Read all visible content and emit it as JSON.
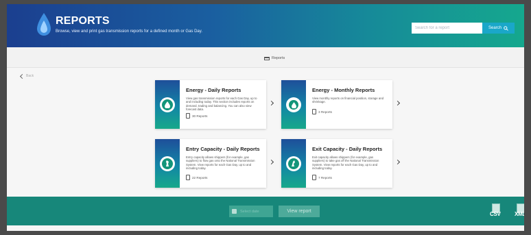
{
  "header": {
    "title": "REPORTS",
    "subtitle": "Browse, view and print gas transmission reports for a defined month or Gas Day.",
    "search_placeholder": "Search for a report",
    "search_label": "Search"
  },
  "breadcrumb": {
    "label": "Reports"
  },
  "back_label": "Back",
  "cards": [
    {
      "title": "Energy - Daily Reports",
      "description": "View gas transmission reports for each Gas Day, up to and including today. This section includes reports on demand, trading and balancing. You can also view forecast data.",
      "count": "30 Reports",
      "icon": "gas-drop-icon"
    },
    {
      "title": "Energy - Monthly Reports",
      "description": "View monthly reports on financial position, storage and shrinkage.",
      "count": "3 Reports",
      "icon": "gas-drop-gear-icon"
    },
    {
      "title": "Entry Capacity - Daily Reports",
      "description": "Entry capacity allows shippers (for example, gas suppliers) to flow gas onto the National Transmission System. View reports for each Gas Day, up to and including today.",
      "count": "22 Reports",
      "icon": "entry-capacity-icon"
    },
    {
      "title": "Exit Capacity - Daily Reports",
      "description": "Exit capacity allows shippers (for example, gas suppliers) to take gas off the National Transmission System. View reports for each Gas Day, up to and including today.",
      "count": "7 Reports",
      "icon": "exit-capacity-icon"
    }
  ],
  "footer": {
    "date_placeholder": "Select date",
    "view_report_label": "View report",
    "csv_label": "CSV",
    "xml_label": "XML"
  },
  "colors": {
    "header_start": "#1b3f8f",
    "header_end": "#15a88e",
    "footer": "#17877a",
    "accent": "#1aa7c9"
  }
}
